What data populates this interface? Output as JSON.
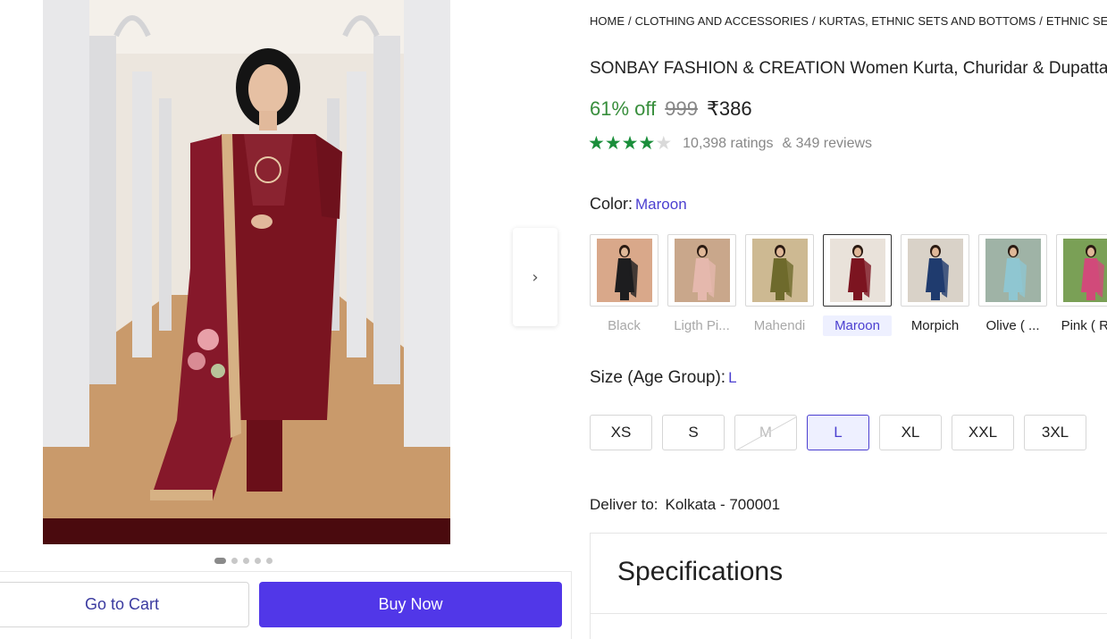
{
  "breadcrumb": [
    {
      "label": "HOME"
    },
    {
      "label": "CLOTHING AND ACCESSORIES"
    },
    {
      "label": "KURTAS, ETHNIC SETS AND BOTTOMS"
    },
    {
      "label": "ETHNIC SETS"
    }
  ],
  "breadcrumb_separator": "/",
  "product": {
    "title": "SONBAY FASHION & CREATION Women Kurta, Churidar & Dupatta Set",
    "discount": "61% off",
    "mrp": "999",
    "price": "₹386",
    "rating_stars": 4,
    "ratings_text": "10,398 ratings",
    "reviews_text": "& 349 reviews"
  },
  "color": {
    "label": "Color:",
    "selected": "Maroon",
    "options": [
      {
        "label": "Black",
        "state": "dim",
        "dress": "#1d1d1f",
        "bg": "#d9a88a"
      },
      {
        "label": "Ligth Pi...",
        "state": "dim",
        "dress": "#e5b8ad",
        "bg": "#c9a78b"
      },
      {
        "label": "Mahendi",
        "state": "dim",
        "dress": "#6e6a2c",
        "bg": "#cdb992"
      },
      {
        "label": "Maroon",
        "state": "selected",
        "dress": "#7c1420",
        "bg": "#e9e2da"
      },
      {
        "label": "Morpich",
        "state": "normal",
        "dress": "#1f3b6e",
        "bg": "#d9d2c8"
      },
      {
        "label": "Olive ( ...",
        "state": "normal",
        "dress": "#8fc6d1",
        "bg": "#9fb3a6"
      },
      {
        "label": "Pink ( R...",
        "state": "normal",
        "dress": "#d14a7a",
        "bg": "#7aa056"
      }
    ]
  },
  "size": {
    "label": "Size (Age Group):",
    "selected": "L",
    "options": [
      {
        "label": "XS",
        "state": "normal"
      },
      {
        "label": "S",
        "state": "normal"
      },
      {
        "label": "M",
        "state": "disabled"
      },
      {
        "label": "L",
        "state": "selected"
      },
      {
        "label": "XL",
        "state": "normal"
      },
      {
        "label": "XXL",
        "state": "normal"
      },
      {
        "label": "3XL",
        "state": "normal"
      }
    ]
  },
  "delivery": {
    "label": "Deliver to:",
    "location": "Kolkata - 700001"
  },
  "specifications": {
    "title": "Specifications"
  },
  "gallery": {
    "next_icon": "chevron-right-icon",
    "next_glyph": "›",
    "dot_count": 5,
    "active_dot": 0
  },
  "actions": {
    "cart_label": "Go to Cart",
    "buy_label": "Buy Now"
  },
  "colors": {
    "accent": "#5137e8",
    "discount_green": "#388e3c",
    "star_green": "#1a8e3a",
    "link_blue": "#4b3fd0"
  }
}
